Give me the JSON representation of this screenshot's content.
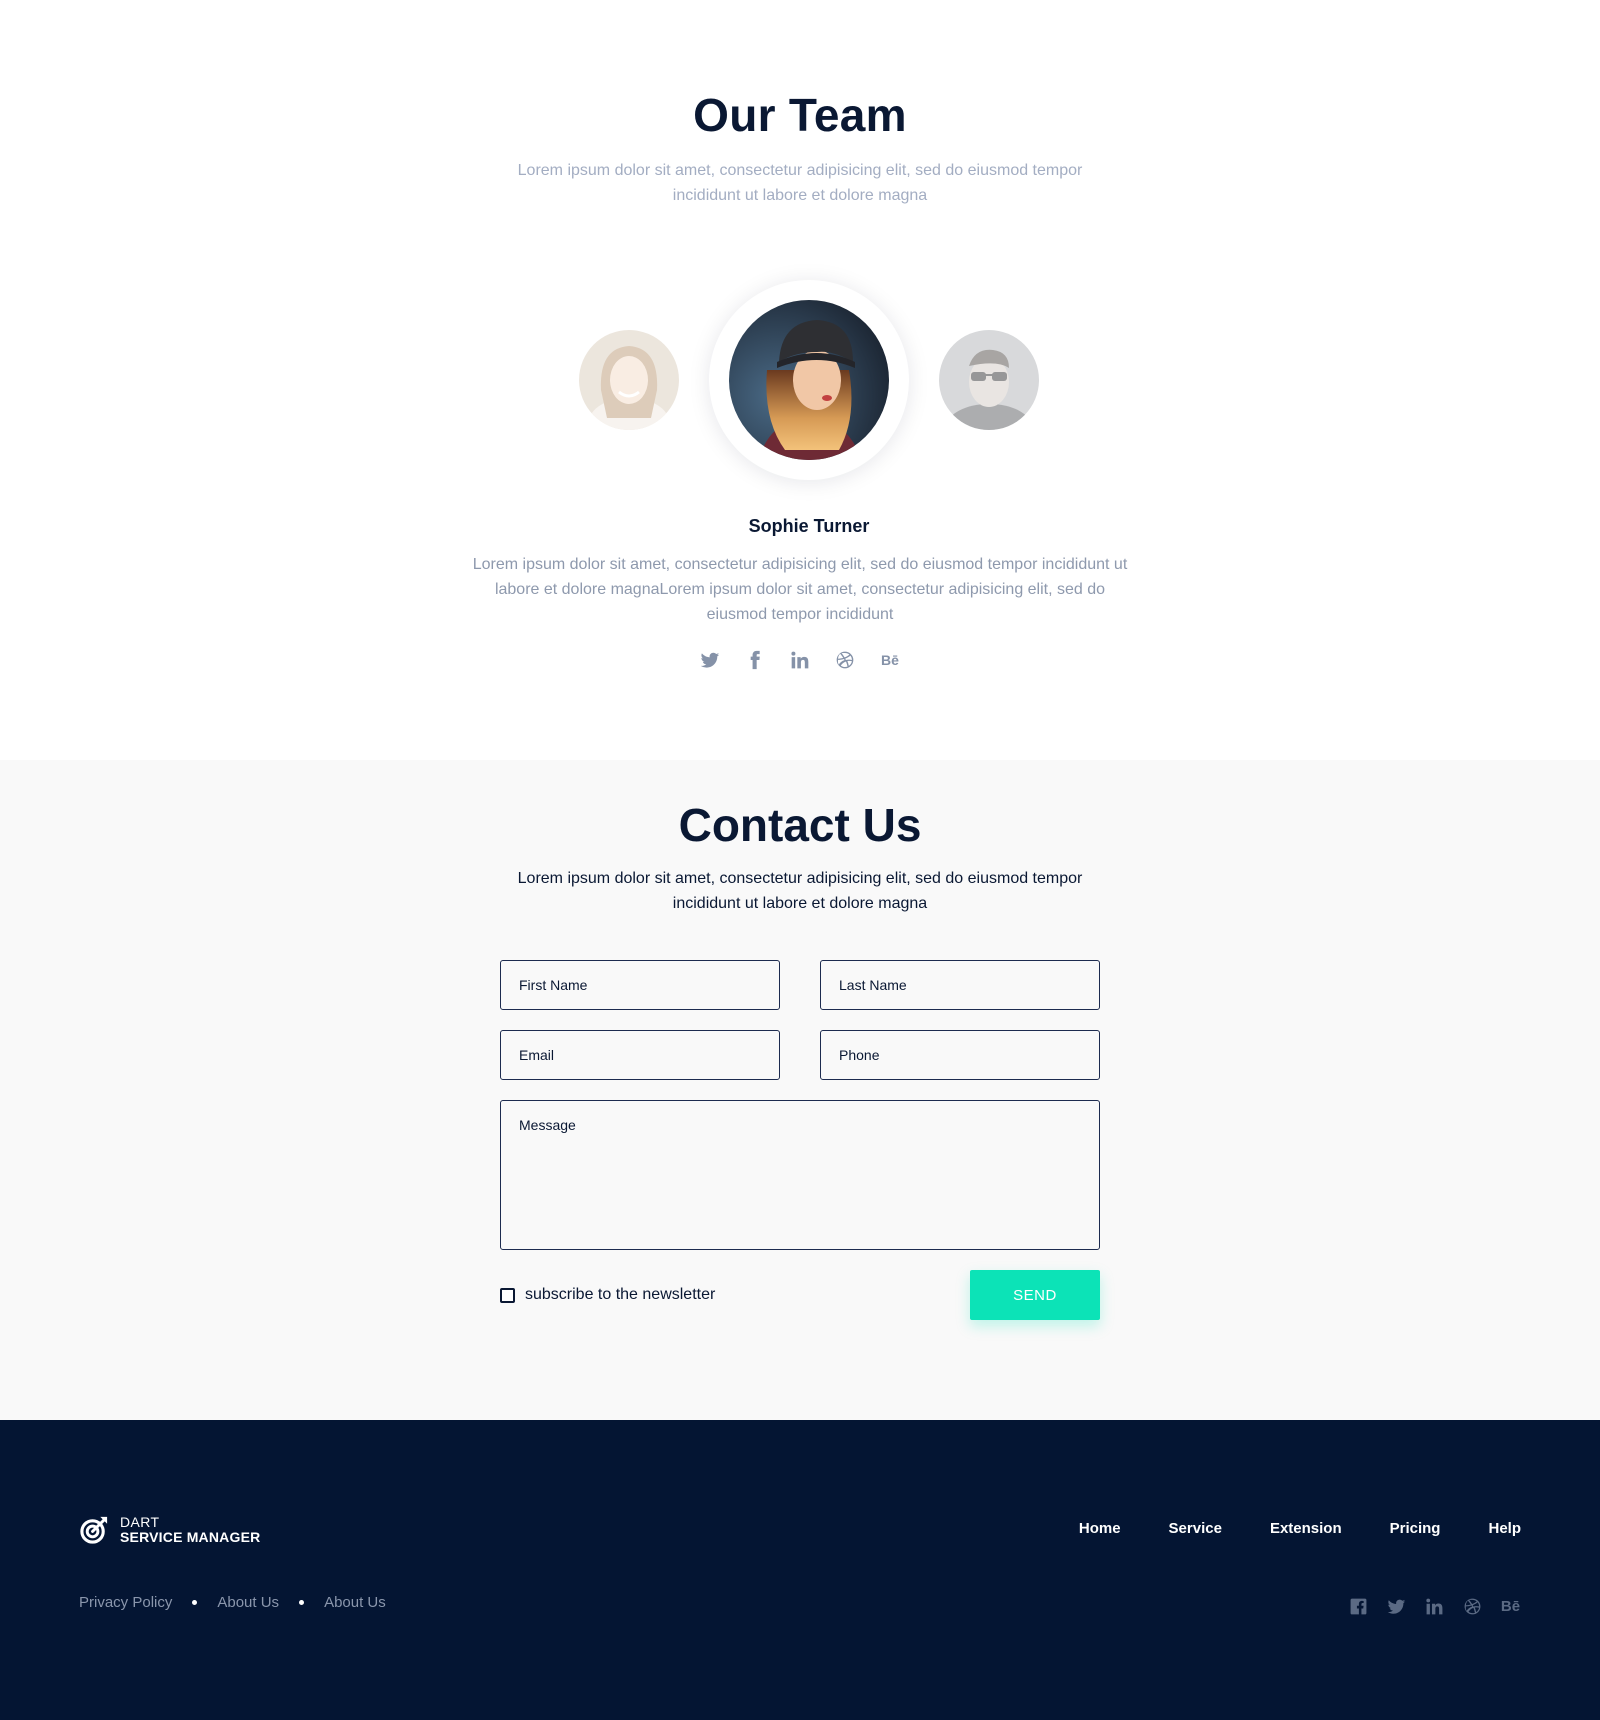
{
  "team": {
    "title": "Our Team",
    "subtitle": "Lorem ipsum dolor sit amet, consectetur adipisicing elit, sed do eiusmod tempor incididunt ut labore et dolore magna",
    "member": {
      "name": "Sophie Turner",
      "bio": "Lorem ipsum dolor sit amet, consectetur adipisicing elit, sed do eiusmod tempor incididunt ut labore et dolore magnaLorem ipsum dolor sit amet, consectetur adipisicing elit, sed do eiusmod tempor incididunt",
      "social_icons": [
        "twitter-icon",
        "facebook-icon",
        "linkedin-icon",
        "dribbble-icon",
        "behance-icon"
      ]
    }
  },
  "contact": {
    "title": "Contact Us",
    "subtitle": "Lorem ipsum dolor sit amet, consectetur adipisicing elit, sed do eiusmod tempor incididunt ut labore et dolore magna",
    "fields": {
      "first_name": "First Name",
      "last_name": "Last Name",
      "email": "Email",
      "phone": "Phone",
      "message": "Message"
    },
    "newsletter_label": "subscribe to the newsletter",
    "newsletter_checked": false,
    "send_label": "SEND",
    "accent_color": "#0ce3b7"
  },
  "footer": {
    "brand_top": "DART",
    "brand_bottom": "SERVICE MANAGER",
    "nav": [
      "Home",
      "Service",
      "Extension",
      "Pricing",
      "Help"
    ],
    "links": [
      "Privacy Policy",
      "About Us",
      "About Us"
    ],
    "behance_text": "Bē",
    "social_icons": [
      "facebook-icon",
      "twitter-icon",
      "linkedin-icon",
      "dribbble-icon",
      "behance-icon"
    ],
    "background_color": "#041533"
  }
}
